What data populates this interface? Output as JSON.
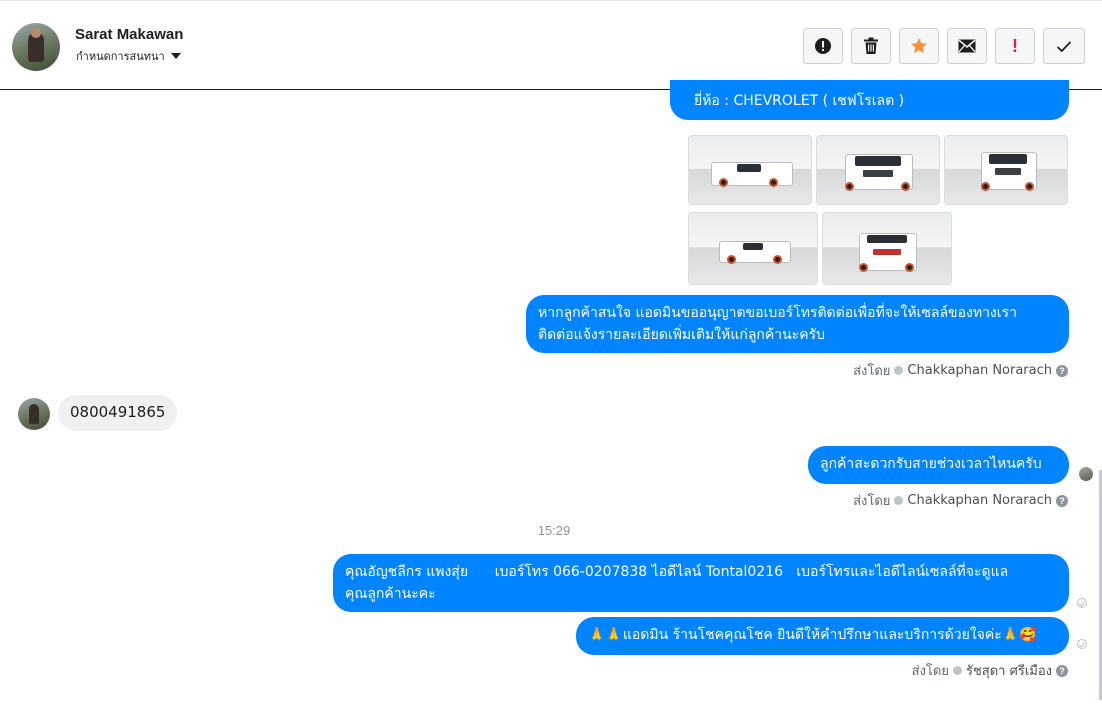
{
  "header": {
    "contact_name": "Sarat Makawan",
    "conversation_label": "กำหนดการสนทนา",
    "tools": [
      {
        "name": "report-icon",
        "label": ""
      },
      {
        "name": "trash-icon",
        "label": ""
      },
      {
        "name": "star-icon",
        "label": ""
      },
      {
        "name": "envelope-icon",
        "label": ""
      },
      {
        "name": "important-icon",
        "label": "!"
      },
      {
        "name": "check-icon",
        "label": ""
      }
    ]
  },
  "messages": {
    "brand_line": "ยี่ห้อ : CHEVROLET ( เชฟโรเลต )",
    "photos_count": 5,
    "request_phone": {
      "line1": "หากลูกค้าสนใจ แอดมินขออนุญาตขอเบอร์โทรติดต่อเพื่อที่จะให้เซลล์ของทางเรา",
      "line2": "ติดต่อแจ้งรายละเอียดเพิ่มเติมให้แก่ลูกค้านะครับ"
    },
    "sent_by_label_1": "ส่งโดย",
    "sender_1": "Chakkaphan Norarach",
    "customer_phone": "0800491865",
    "ask_time": "ลูกค้าสะดวกรับสายช่วงเวลาไหนครับ",
    "sent_by_label_2": "ส่งโดย",
    "sender_2": "Chakkaphan Norarach",
    "timestamp": "15:29",
    "sales_info": {
      "line1": "คุณอัญชลีกร แพงสุ่ย      เบอร์โทร 066-0207838 ไอดีไลน์ Tontal0216   เบอร์โทรและไอดีไลน์เซลล์ที่จะดูแล",
      "line2": "คุณลูกค้านะคะ"
    },
    "thanks": "🙏🙏แอดมิน ร้านโชคคุณโชค ยินดีให้คำปรึกษาและบริการด้วยใจค่ะ🙏🥰",
    "sent_by_label_3": "ส่งโดย",
    "sender_3": "รัชสุดา ศรีเมือง"
  }
}
